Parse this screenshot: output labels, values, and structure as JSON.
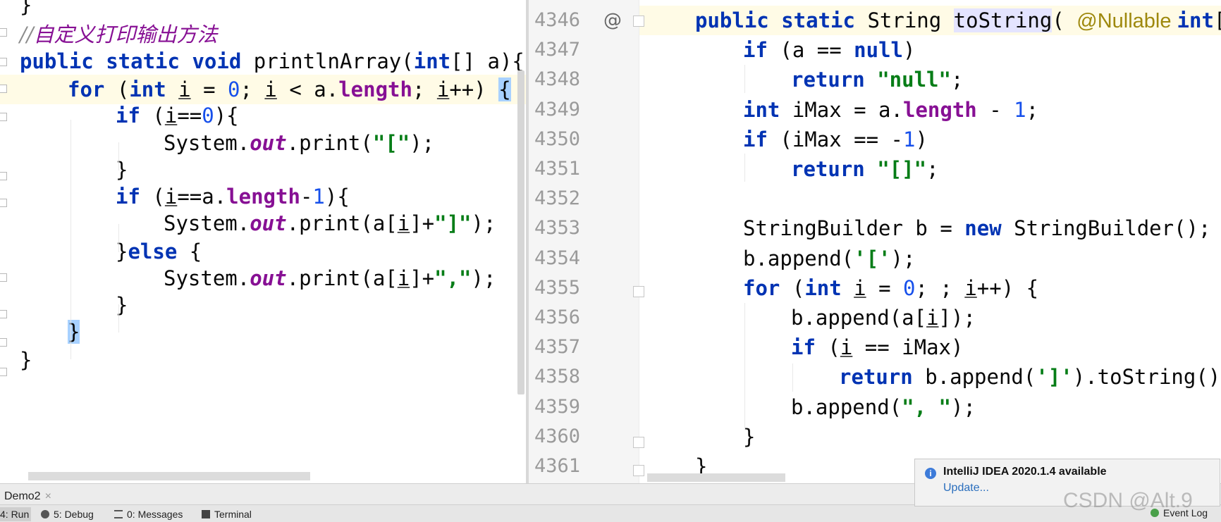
{
  "left_editor": {
    "lines": [
      {
        "id": "closing-brace-top",
        "segments": [
          [
            "p",
            "}"
          ]
        ]
      },
      {
        "id": "comment",
        "segments": [
          [
            "cmt",
            "//"
          ],
          [
            "cn",
            "自定义打印输出方法"
          ]
        ]
      },
      {
        "id": "method-signature",
        "segments": [
          [
            "kw",
            "public "
          ],
          [
            "kw",
            "static "
          ],
          [
            "kw",
            "void "
          ],
          [
            "p",
            "printlnArray("
          ],
          [
            "kw",
            "int"
          ],
          [
            "p",
            "[] a){"
          ]
        ]
      },
      {
        "id": "for-loop",
        "segments": [
          [
            "kw",
            "for "
          ],
          [
            "p",
            "("
          ],
          [
            "kw",
            "int "
          ],
          [
            "ul",
            "i"
          ],
          [
            "p",
            " = "
          ],
          [
            "num",
            "0"
          ],
          [
            "p",
            "; "
          ],
          [
            "ul",
            "i"
          ],
          [
            "p",
            " < a."
          ],
          [
            "fld",
            "length"
          ],
          [
            "p",
            "; "
          ],
          [
            "ul",
            "i"
          ],
          [
            "p",
            "++) "
          ],
          [
            "bh",
            "{"
          ]
        ]
      },
      {
        "id": "if-first",
        "segments": [
          [
            "kw",
            "if "
          ],
          [
            "p",
            "("
          ],
          [
            "ul",
            "i"
          ],
          [
            "p",
            "=="
          ],
          [
            "num",
            "0"
          ],
          [
            "p",
            "){"
          ]
        ]
      },
      {
        "id": "print-open",
        "segments": [
          [
            "p",
            "System."
          ],
          [
            "stat",
            "out"
          ],
          [
            "p",
            ".print("
          ],
          [
            "str",
            "\"[\""
          ],
          [
            "p",
            ");"
          ]
        ]
      },
      {
        "id": "if-first-close",
        "segments": [
          [
            "p",
            "}"
          ]
        ]
      },
      {
        "id": "if-last",
        "segments": [
          [
            "kw",
            "if "
          ],
          [
            "p",
            "("
          ],
          [
            "ul",
            "i"
          ],
          [
            "p",
            "==a."
          ],
          [
            "fld",
            "length"
          ],
          [
            "p",
            "-"
          ],
          [
            "num",
            "1"
          ],
          [
            "p",
            "){"
          ]
        ]
      },
      {
        "id": "print-last",
        "segments": [
          [
            "p",
            "System."
          ],
          [
            "stat",
            "out"
          ],
          [
            "p",
            ".print(a["
          ],
          [
            "ul",
            "i"
          ],
          [
            "p",
            "]+"
          ],
          [
            "str",
            "\"]\""
          ],
          [
            "p",
            ");"
          ]
        ]
      },
      {
        "id": "else",
        "segments": [
          [
            "p",
            "}"
          ],
          [
            "kw",
            "else "
          ],
          [
            "p",
            "{"
          ]
        ]
      },
      {
        "id": "print-comma",
        "segments": [
          [
            "p",
            "System."
          ],
          [
            "stat",
            "out"
          ],
          [
            "p",
            ".print(a["
          ],
          [
            "ul",
            "i"
          ],
          [
            "p",
            "]+"
          ],
          [
            "str",
            "\",\""
          ],
          [
            "p",
            ");"
          ]
        ]
      },
      {
        "id": "else-close",
        "segments": [
          [
            "p",
            "}"
          ]
        ]
      },
      {
        "id": "for-close",
        "segments": [
          [
            "bh",
            "}"
          ]
        ]
      },
      {
        "id": "method-close",
        "segments": [
          [
            "p",
            "}"
          ]
        ]
      }
    ]
  },
  "right_editor": {
    "gutter_icon": "@",
    "line_numbers": [
      "4346",
      "4347",
      "4348",
      "4349",
      "4350",
      "4351",
      "4352",
      "4353",
      "4354",
      "4355",
      "4356",
      "4357",
      "4358",
      "4359",
      "4360",
      "4361"
    ],
    "lines": [
      {
        "id": "tostring-signature",
        "segments": [
          [
            "kw",
            "public "
          ],
          [
            "kw",
            "static "
          ],
          [
            "p",
            "String "
          ],
          [
            "ih",
            "toString"
          ],
          [
            "p",
            "( "
          ],
          [
            "ann",
            "@Nullable "
          ],
          [
            "kw",
            "int"
          ],
          [
            "p",
            "[]"
          ]
        ]
      },
      {
        "id": "if-null",
        "segments": [
          [
            "kw",
            "if "
          ],
          [
            "p",
            "(a == "
          ],
          [
            "kw",
            "null"
          ],
          [
            "p",
            ")"
          ]
        ]
      },
      {
        "id": "return-null",
        "segments": [
          [
            "kw",
            "return "
          ],
          [
            "str",
            "\"null\""
          ],
          [
            "p",
            ";"
          ]
        ]
      },
      {
        "id": "imax-decl",
        "segments": [
          [
            "kw",
            "int "
          ],
          [
            "p",
            "iMax = a."
          ],
          [
            "fld",
            "length"
          ],
          [
            "p",
            " - "
          ],
          [
            "num",
            "1"
          ],
          [
            "p",
            ";"
          ]
        ]
      },
      {
        "id": "if-imax",
        "segments": [
          [
            "kw",
            "if "
          ],
          [
            "p",
            "(iMax == -"
          ],
          [
            "num",
            "1"
          ],
          [
            "p",
            ")"
          ]
        ]
      },
      {
        "id": "return-empty",
        "segments": [
          [
            "kw",
            "return "
          ],
          [
            "str",
            "\"[]\""
          ],
          [
            "p",
            ";"
          ]
        ]
      },
      {
        "id": "blank",
        "segments": []
      },
      {
        "id": "sb-decl",
        "segments": [
          [
            "p",
            "StringBuilder b = "
          ],
          [
            "kw",
            "new "
          ],
          [
            "p",
            "StringBuilder();"
          ]
        ]
      },
      {
        "id": "append-open",
        "segments": [
          [
            "p",
            "b.append("
          ],
          [
            "str",
            "'['"
          ],
          [
            "p",
            ");"
          ]
        ]
      },
      {
        "id": "for-loop-r",
        "segments": [
          [
            "kw",
            "for "
          ],
          [
            "p",
            "("
          ],
          [
            "kw",
            "int "
          ],
          [
            "ul",
            "i"
          ],
          [
            "p",
            " = "
          ],
          [
            "num",
            "0"
          ],
          [
            "p",
            "; ; "
          ],
          [
            "ul",
            "i"
          ],
          [
            "p",
            "++) {"
          ]
        ]
      },
      {
        "id": "append-elem",
        "segments": [
          [
            "p",
            "b.append(a["
          ],
          [
            "ul",
            "i"
          ],
          [
            "p",
            "]);"
          ]
        ]
      },
      {
        "id": "if-last-r",
        "segments": [
          [
            "kw",
            "if "
          ],
          [
            "p",
            "("
          ],
          [
            "ul",
            "i"
          ],
          [
            "p",
            " == iMax)"
          ]
        ]
      },
      {
        "id": "return-close",
        "segments": [
          [
            "kw",
            "return "
          ],
          [
            "p",
            "b.append("
          ],
          [
            "str",
            "']'"
          ],
          [
            "p",
            ").toString();"
          ]
        ]
      },
      {
        "id": "append-sep",
        "segments": [
          [
            "p",
            "b.append("
          ],
          [
            "str",
            "\", \""
          ],
          [
            "p",
            ");"
          ]
        ]
      },
      {
        "id": "for-close-r",
        "segments": [
          [
            "p",
            "}"
          ]
        ]
      },
      {
        "id": "method-close-r",
        "segments": [
          [
            "p",
            "}"
          ]
        ]
      }
    ]
  },
  "bottom": {
    "run_tab": {
      "label": "Demo2",
      "close": "×"
    },
    "tools": [
      {
        "label": "4: Run",
        "icon": "run-icon"
      },
      {
        "label": "5: Debug",
        "icon": "debug-icon"
      },
      {
        "label": "0: Messages",
        "icon": "messages-icon"
      },
      {
        "label": "Terminal",
        "icon": "terminal-icon"
      }
    ],
    "event_log": "Event Log"
  },
  "notification": {
    "title": "IntelliJ IDEA 2020.1.4 available",
    "link": "Update..."
  },
  "watermark": "CSDN @Alt.9"
}
